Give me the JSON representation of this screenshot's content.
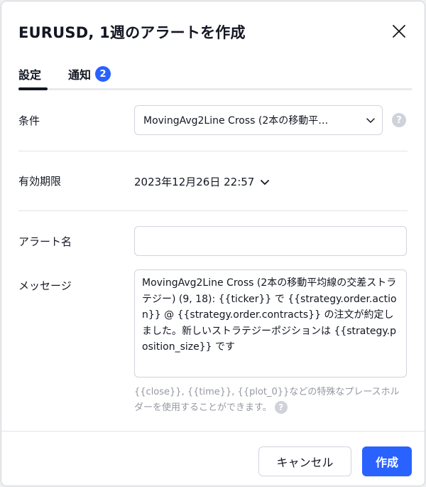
{
  "dialog": {
    "title": "EURUSD, 1週のアラートを作成"
  },
  "tabs": [
    {
      "label": "設定",
      "active": true
    },
    {
      "label": "通知",
      "badge": "2"
    }
  ],
  "condition": {
    "label": "条件",
    "value": "MovingAvg2Line Cross (2本の移動平…"
  },
  "expiry": {
    "label": "有効期限",
    "value": "2023年12月26日 22:57"
  },
  "alert_name": {
    "label": "アラート名",
    "value": "",
    "placeholder": ""
  },
  "message": {
    "label": "メッセージ",
    "value": "MovingAvg2Line Cross (2本の移動平均線の交差ストラテジー) (9, 18): {{ticker}} で {{strategy.order.action}} @ {{strategy.order.contracts}} の注文が約定しました。新しいストラテジーポジションは {{strategy.position_size}} です",
    "hint": "{{close}}, {{time}}, {{plot_0}}などの特殊なプレースホルダーを使用することができます。"
  },
  "buttons": {
    "cancel": "キャンセル",
    "create": "作成"
  },
  "icons": {
    "help": "?",
    "close": "close-icon",
    "chevron": "chevron-down-icon"
  },
  "colors": {
    "accent": "#2962ff",
    "text": "#131722",
    "muted": "#9598a1",
    "border": "#d1d4dc"
  }
}
